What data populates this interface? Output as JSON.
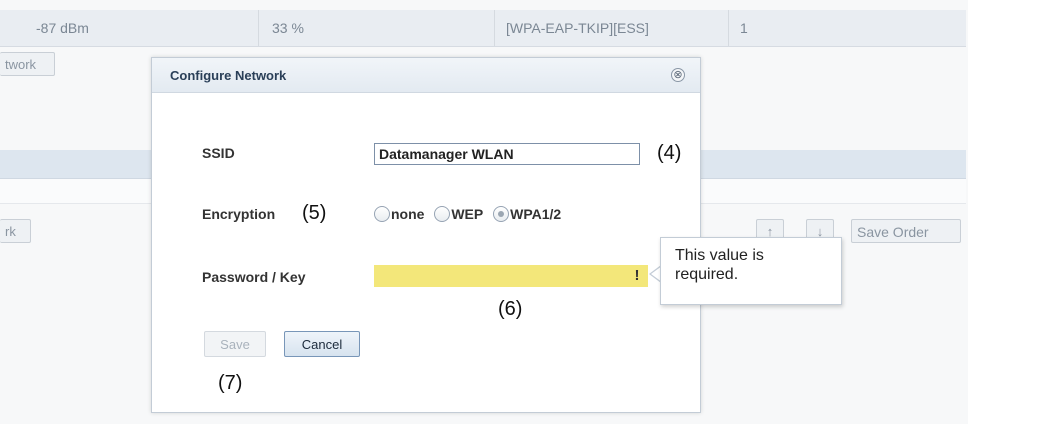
{
  "background": {
    "network_row": {
      "signal": "-87 dBm",
      "quality": "33 %",
      "encryption": "[WPA-EAP-TKIP][ESS]",
      "channel": "1"
    },
    "add_network_button_partial": "twork",
    "remove_network_button_partial": "rk",
    "move_up_icon": "↑",
    "move_down_icon": "↓",
    "save_order_label": "Save Order"
  },
  "dialog": {
    "title": "Configure Network",
    "close_icon": "⊗",
    "ssid": {
      "label": "SSID",
      "value": "Datamanager WLAN"
    },
    "encryption": {
      "label": "Encryption",
      "options": [
        "none",
        "WEP",
        "WPA1/2"
      ],
      "selected": "WPA1/2"
    },
    "password": {
      "label": "Password / Key",
      "value": "",
      "warning_icon": "!"
    },
    "tooltip": "This value is required.",
    "buttons": {
      "save": "Save",
      "cancel": "Cancel"
    }
  },
  "annotations": {
    "ssid": "(4)",
    "encryption": "(5)",
    "password": "(6)",
    "buttons": "(7)"
  },
  "colors": {
    "required_field": "#f3e77a",
    "title_text": "#2a3f58",
    "header_band": "#dde6ef"
  }
}
